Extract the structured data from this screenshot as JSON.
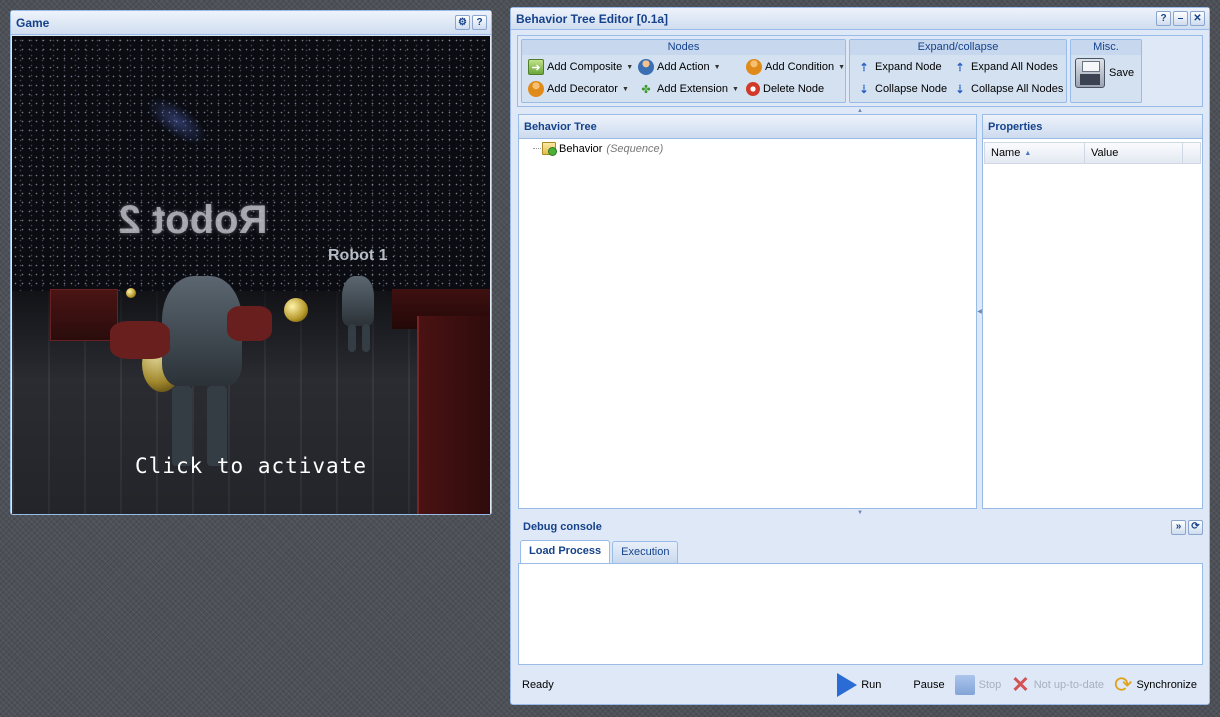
{
  "game": {
    "title": "Game",
    "robot2_label": "Robot 2",
    "robot1_label": "Robot 1",
    "overlay_text": "Click to activate"
  },
  "editor": {
    "title": "Behavior Tree Editor [0.1a]",
    "toolbar": {
      "nodes_group": "Nodes",
      "add_composite": "Add Composite",
      "add_action": "Add Action",
      "add_condition": "Add Condition",
      "add_decorator": "Add Decorator",
      "add_extension": "Add Extension",
      "delete_node": "Delete Node",
      "expand_group": "Expand/collapse",
      "expand_node": "Expand Node",
      "expand_all": "Expand All Nodes",
      "collapse_node": "Collapse Node",
      "collapse_all": "Collapse All Nodes",
      "misc_group": "Misc.",
      "save": "Save"
    },
    "tree_panel": {
      "title": "Behavior Tree",
      "root": {
        "name": "Behavior",
        "type": "(Sequence)"
      }
    },
    "properties_panel": {
      "title": "Properties",
      "columns": [
        "Name",
        "Value"
      ]
    },
    "debug": {
      "title": "Debug console",
      "tabs": [
        "Load Process",
        "Execution"
      ],
      "active_tab": "Load Process"
    },
    "status": {
      "text": "Ready",
      "run": "Run",
      "pause": "Pause",
      "stop": "Stop",
      "not_up_to_date": "Not up-to-date",
      "synchronize": "Synchronize"
    }
  },
  "colors": {
    "accent": "#15428b",
    "panel_border": "#99bbe8",
    "panel_bg": "#dfe8f6",
    "run_blue": "#2a6bd6"
  }
}
